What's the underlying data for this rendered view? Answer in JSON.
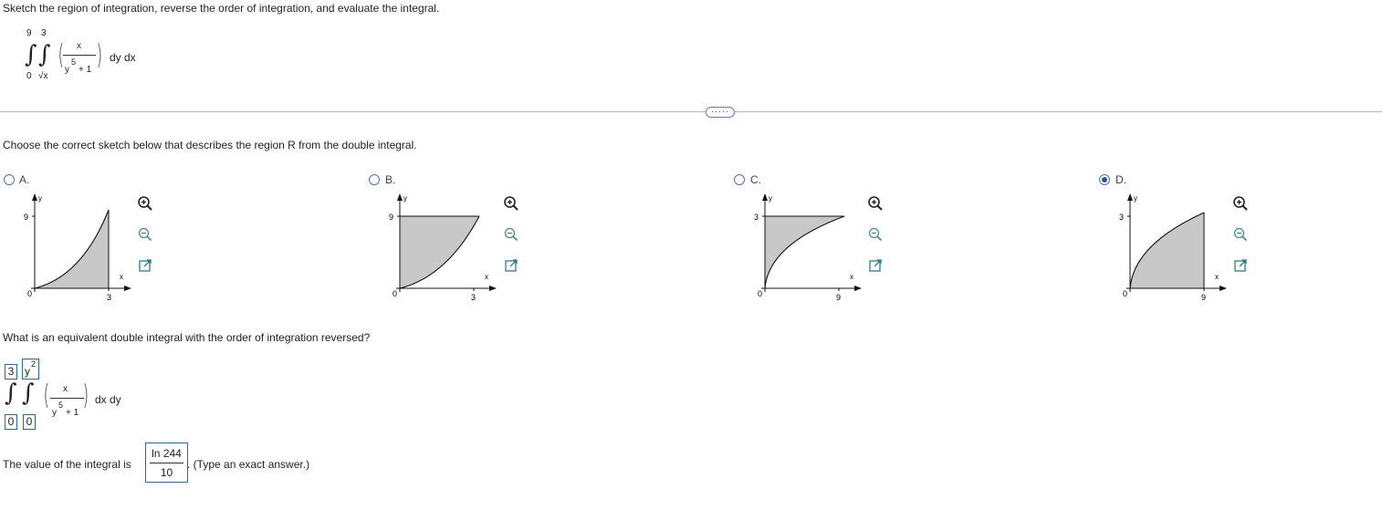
{
  "prompt": "Sketch the region of integration, reverse the order of integration, and evaluate the integral.",
  "original_integral": {
    "outer_upper": "9",
    "outer_lower": "0",
    "inner_upper": "3",
    "inner_lower": "√x",
    "numerator": "x",
    "den_base": "y",
    "den_exp": "5",
    "den_plus": "+ 1",
    "differentials": "dy dx"
  },
  "more_button": "·····",
  "question_sketch": "Choose the correct sketch below that describes the region R from the double integral.",
  "options": [
    {
      "label": "A.",
      "selected": false,
      "y_tick": "9",
      "x_tick": "3",
      "x_axis": "x",
      "y_axis": "y",
      "origin": "0"
    },
    {
      "label": "B.",
      "selected": false,
      "y_tick": "9",
      "x_tick": "3",
      "x_axis": "x",
      "y_axis": "y",
      "origin": "0"
    },
    {
      "label": "C.",
      "selected": false,
      "y_tick": "3",
      "x_tick": "9",
      "x_axis": "x",
      "y_axis": "y",
      "origin": "0"
    },
    {
      "label": "D.",
      "selected": true,
      "y_tick": "3",
      "x_tick": "9",
      "x_axis": "x",
      "y_axis": "y",
      "origin": "0"
    }
  ],
  "tool_icons": [
    "zoom-in-icon",
    "zoom-out-icon",
    "open-external-icon"
  ],
  "question_reverse": "What is an equivalent double integral with the order of integration reversed?",
  "reversed_integral": {
    "outer_upper": "3",
    "outer_lower": "0",
    "inner_upper_base": "y",
    "inner_upper_exp": "2",
    "inner_lower": "0",
    "numerator": "x",
    "den_base": "y",
    "den_exp": "5",
    "den_plus": "+ 1",
    "differentials": "dx dy"
  },
  "value_prefix": "The value of the integral is",
  "answer": {
    "numerator": "ln 244",
    "denominator": "10"
  },
  "value_suffix": ". (Type an exact answer.)",
  "colors": {
    "accent": "#2a5298",
    "shade": "#c8c8c8",
    "box_border": "#2e6a8f"
  }
}
